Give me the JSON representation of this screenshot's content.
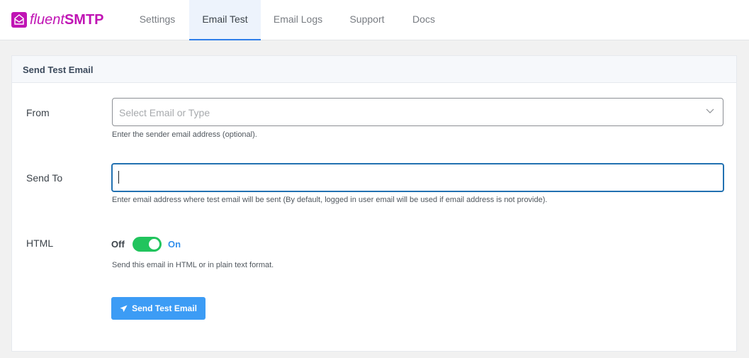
{
  "app": {
    "logo_prefix": "fluent",
    "logo_suffix": "SMTP",
    "brand_color": "#c014b4"
  },
  "nav": {
    "tabs": [
      {
        "label": "Settings",
        "active": false
      },
      {
        "label": "Email Test",
        "active": true
      },
      {
        "label": "Email Logs",
        "active": false
      },
      {
        "label": "Support",
        "active": false
      },
      {
        "label": "Docs",
        "active": false
      }
    ]
  },
  "card": {
    "title": "Send Test Email"
  },
  "form": {
    "from": {
      "label": "From",
      "placeholder": "Select Email or Type",
      "help": "Enter the sender email address (optional)."
    },
    "send_to": {
      "label": "Send To",
      "value": "",
      "help": "Enter email address where test email will be sent (By default, logged in user email will be used if email address is not provide)."
    },
    "html": {
      "label": "HTML",
      "off_label": "Off",
      "on_label": "On",
      "enabled": true,
      "help": "Send this email in HTML or in plain text format."
    },
    "submit_label": "Send Test Email"
  },
  "colors": {
    "accent": "#2f7ee9",
    "toggle_on": "#21c45d",
    "button": "#3c9cf5"
  }
}
